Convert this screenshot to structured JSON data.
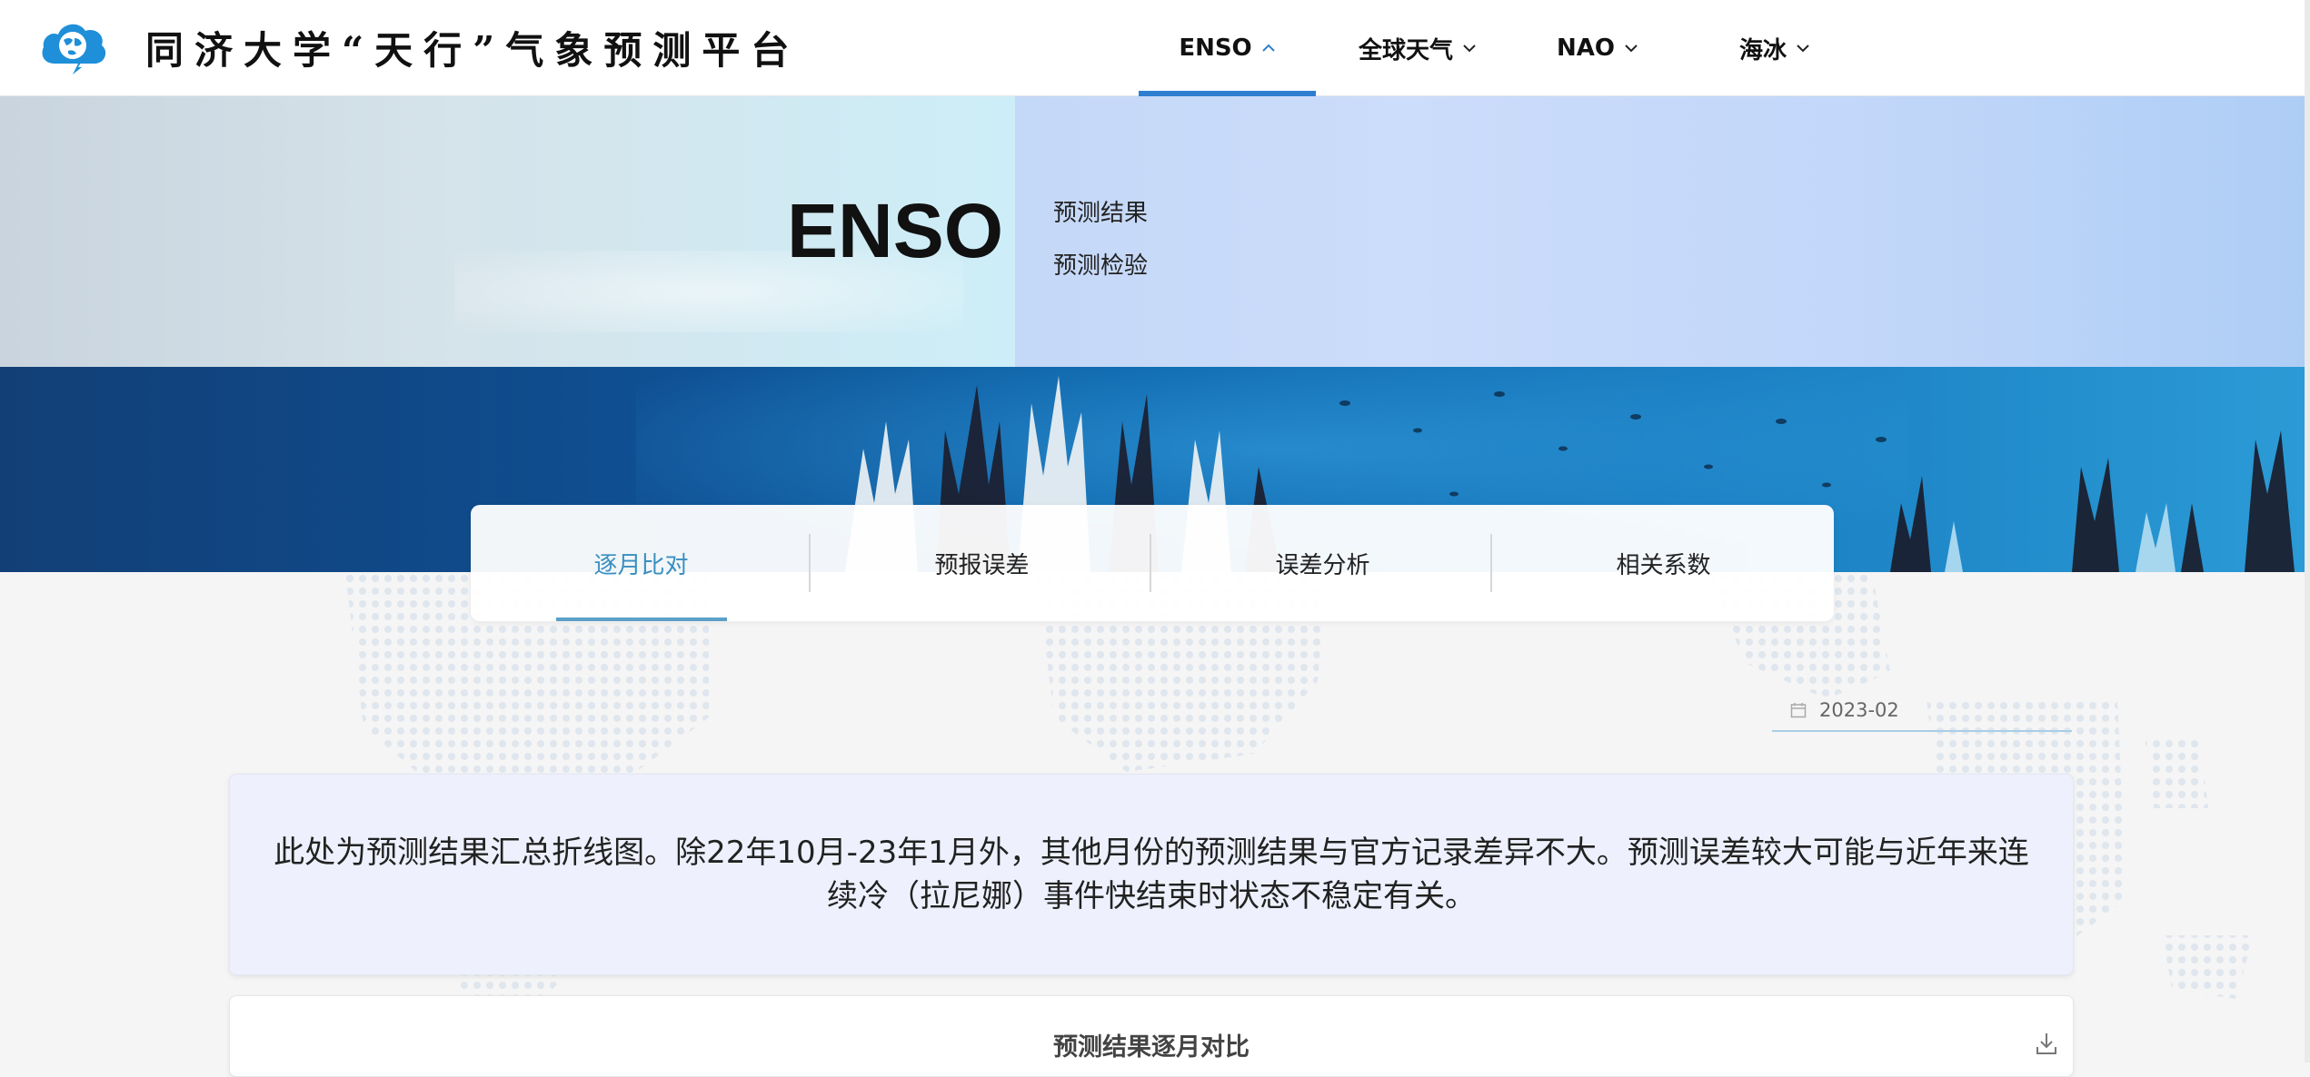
{
  "header": {
    "logo_icon": "cloud-globe-icon",
    "brand_title": "同济大学“天行”气象预测平台",
    "nav": [
      {
        "label": "ENSO",
        "active": true,
        "icon": "chevron-up-icon"
      },
      {
        "label": "全球天气",
        "active": false,
        "icon": "chevron-down-icon"
      },
      {
        "label": "NAO",
        "active": false,
        "icon": "chevron-down-icon"
      },
      {
        "label": "海冰",
        "active": false,
        "icon": "chevron-down-icon"
      }
    ],
    "accent_color": "#2f7fd0"
  },
  "hero": {
    "title": "ENSO",
    "links": [
      "预测结果",
      "预测检验"
    ]
  },
  "tabs": {
    "items": [
      "逐月比对",
      "预报误差",
      "误差分析",
      "相关系数"
    ],
    "active_index": 0,
    "active_color": "#3a8fc0"
  },
  "date_picker": {
    "icon": "calendar-icon",
    "value": "2023-02"
  },
  "info": {
    "text": "此处为预测结果汇总折线图。除22年10月-23年1月外，其他月份的预测结果与官方记录差异不大。预测误差较大可能与近年来连续冷（拉尼娜）事件快结束时状态不稳定有关。"
  },
  "chart_card": {
    "title": "预测结果逐月对比",
    "download_icon": "download-icon"
  }
}
